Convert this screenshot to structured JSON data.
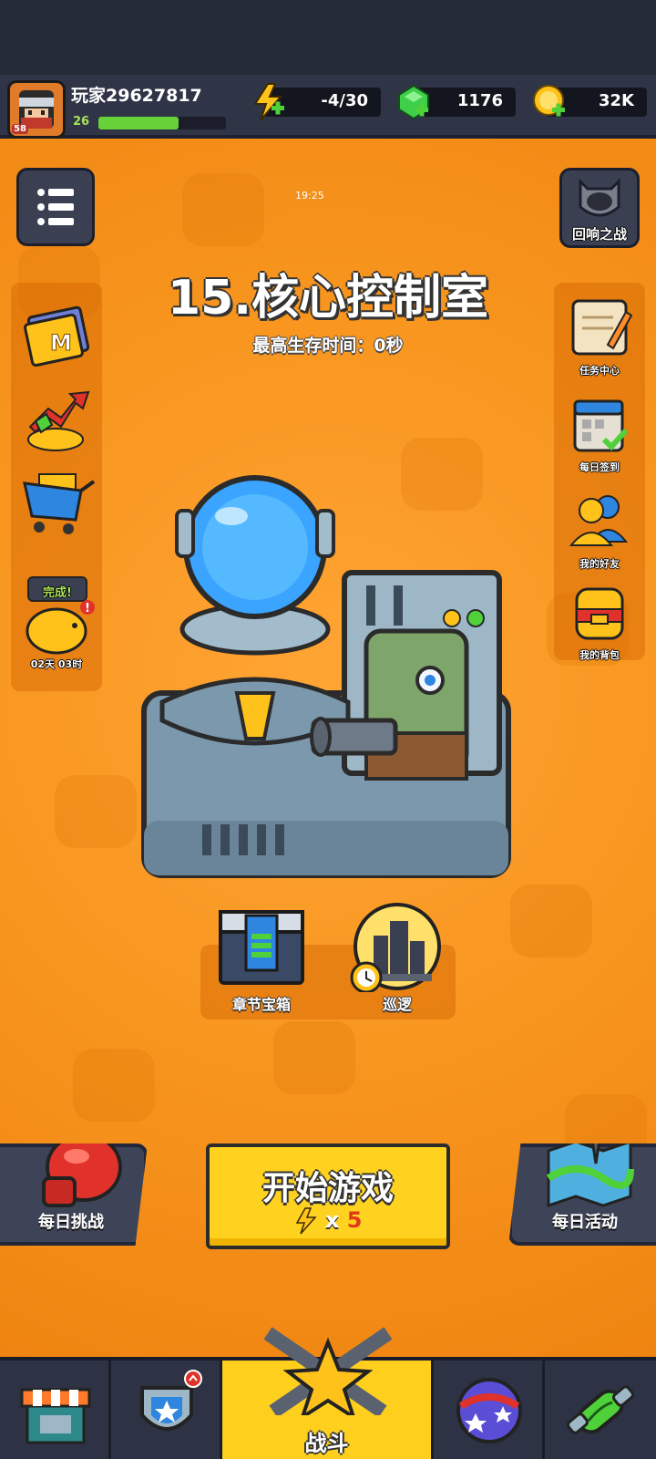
{
  "player": {
    "name": "玩家29627817",
    "level": "26",
    "avatar_level": "58",
    "xp_fraction": 0.63
  },
  "resources": {
    "energy": {
      "value": "-4/30",
      "timer": "19:25",
      "icon": "lightning-icon"
    },
    "gems": {
      "value": "1176",
      "icon": "green-gem-icon"
    },
    "coins": {
      "value": "32K",
      "icon": "gold-coin-icon"
    }
  },
  "stage": {
    "title": "15.核心控制室",
    "best_survival": "最高生存时间：0秒"
  },
  "left_menu": {
    "piggy_status": "完成!",
    "piggy_timer": "02天 03时"
  },
  "right_top": {
    "echo_battle": "回响之战"
  },
  "right_menu": [
    {
      "label": "任务中心",
      "icon": "quest-scroll-icon"
    },
    {
      "label": "每日签到",
      "icon": "calendar-check-icon"
    },
    {
      "label": "我的好友",
      "icon": "friends-icon"
    },
    {
      "label": "我的背包",
      "icon": "backpack-icon"
    }
  ],
  "chapter_chest": "章节宝箱",
  "patrol": "巡逻",
  "start": {
    "label": "开始游戏",
    "cost_multiplier": "x",
    "cost_value": "5"
  },
  "daily_challenge": "每日挑战",
  "daily_event": "每日活动",
  "nav": {
    "battle": "战斗"
  },
  "colors": {
    "background": "#f7941d",
    "start_button": "#ffd21f",
    "topbar": "#2f3446"
  }
}
